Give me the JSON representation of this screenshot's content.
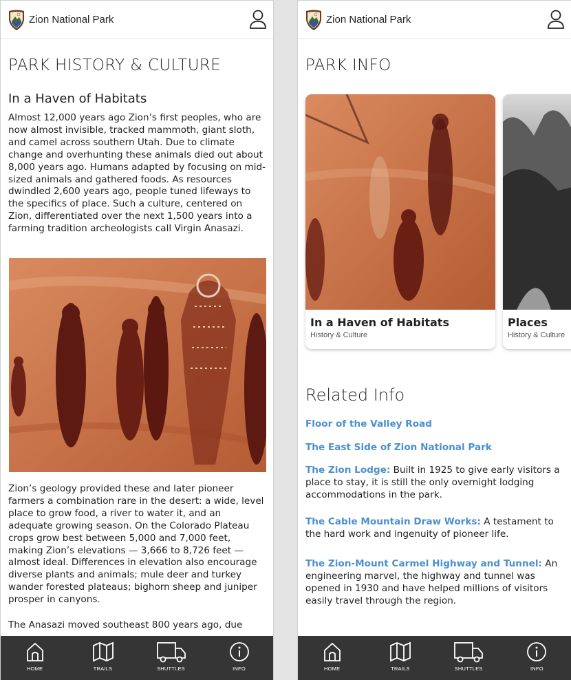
{
  "brand": {
    "name": "Zion National Park"
  },
  "nav": [
    {
      "key": "home",
      "label": "HOME"
    },
    {
      "key": "trails",
      "label": "TRAILS"
    },
    {
      "key": "shuttles",
      "label": "SHUTTLES"
    },
    {
      "key": "info",
      "label": "INFO"
    }
  ],
  "left": {
    "page_title": "PARK HISTORY & CULTURE",
    "article_title": "In a Haven of Habitats",
    "paragraphs": [
      "Almost 12,000 years ago Zion’s first peoples, who are now almost invisible, tracked mammoth, giant sloth, and camel across southern Utah. Due to climate change and overhunting these animals died out about 8,000 years ago. Humans adapted by focusing on mid-sized animals and gathered foods. As resources dwindled 2,600 years ago, people tuned lifeways to the specifics of place. Such a culture, centered on Zion, differentiated over the next 1,500 years into a farming tradition archeologists call Virgin Anasazi.",
      "Zion’s geology provided these and later pioneer farmers a combination rare in the desert: a wide, level place to grow food, a river to water it, and an adequate growing season. On the Colorado Plateau crops grow best between 5,000 and 7,000 feet, making Zion’s elevations — 3,666 to 8,726 feet — almost ideal. Differences in elevation also encourage diverse plants and animals; mule deer and turkey wander forested plateaus; bighorn sheep and juniper prosper in canyons.",
      "The Anasazi moved southeast 800 years ago, due"
    ]
  },
  "right": {
    "page_title": "PARK INFO",
    "cards": [
      {
        "title": "In a Haven of Habitats",
        "subtitle": "History & Culture"
      },
      {
        "title": "Places",
        "subtitle": "History & Culture"
      }
    ],
    "related_title": "Related Info",
    "related": [
      {
        "link": "Floor of the Valley Road",
        "text": ""
      },
      {
        "link": "The East Side of Zion National Park",
        "text": ""
      },
      {
        "link": "The Zion Lodge:",
        "text": "Built in 1925 to give early visitors a place to stay, it is still the only overnight lodging accommodations in the park."
      },
      {
        "link": "The Cable Mountain Draw Works:",
        "text": "A testament to the hard work and ingenuity of pioneer life."
      },
      {
        "link": "The Zion-Mount Carmel Highway and Tunnel:",
        "text": "An engineering marvel, the highway and tunnel was opened in 1930 and have helped millions of visitors easily travel through the region."
      }
    ]
  },
  "colors": {
    "link": "#4a8fcf",
    "nav_bg": "#353535",
    "rock": "#c8734a"
  }
}
